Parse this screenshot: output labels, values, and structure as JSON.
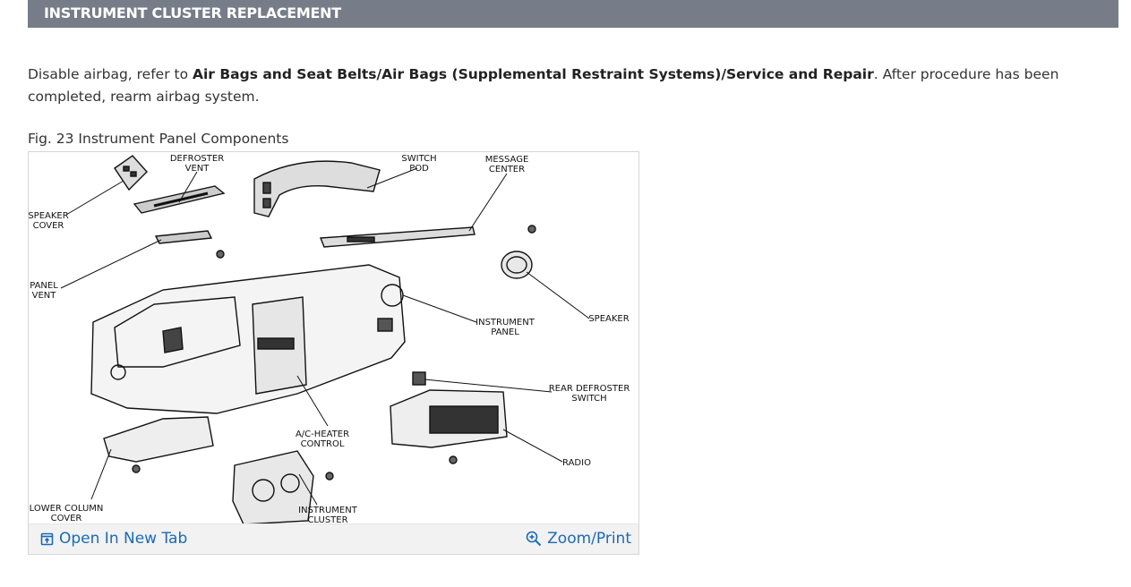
{
  "header": {
    "title": "INSTRUMENT CLUSTER REPLACEMENT"
  },
  "instruction": {
    "prefix": "Disable airbag, refer to ",
    "link_text": "Air Bags and Seat Belts/Air Bags (Supplemental Restraint Systems)/Service and Repair",
    "suffix": ". After procedure has been completed, rearm airbag system."
  },
  "figure": {
    "caption": "Fig. 23 Instrument Panel Components",
    "labels": {
      "defroster_vent": [
        "DEFROSTER",
        "VENT"
      ],
      "switch_pod": [
        "SWITCH",
        "POD"
      ],
      "message_center": [
        "MESSAGE",
        "CENTER"
      ],
      "speaker_cover": [
        "SPEAKER",
        "COVER"
      ],
      "panel_vent": [
        "PANEL",
        "VENT"
      ],
      "speaker": [
        "SPEAKER"
      ],
      "instrument_panel": [
        "INSTRUMENT",
        "PANEL"
      ],
      "rear_defroster_switch": [
        "REAR DEFROSTER",
        "SWITCH"
      ],
      "ac_heater_control": [
        "A/C-HEATER",
        "CONTROL"
      ],
      "radio": [
        "RADIO"
      ],
      "lower_column_cover": [
        "LOWER COLUMN",
        "COVER"
      ],
      "instrument_cluster": [
        "INSTRUMENT",
        "CLUSTER"
      ]
    },
    "open_tab_label": "Open In New Tab",
    "zoom_label": "Zoom/Print",
    "link_color": "#1a6ab5",
    "header_color": "#767d88"
  }
}
